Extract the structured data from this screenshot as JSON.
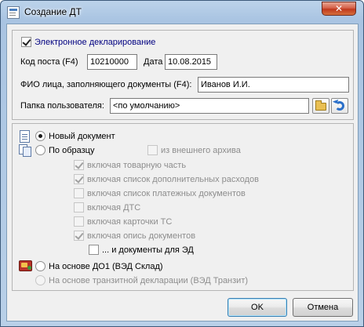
{
  "window": {
    "title": "Создание ДТ",
    "close_glyph": "✕"
  },
  "group1": {
    "e_declaration": {
      "label": "Электронное декларирование",
      "checked": true
    },
    "post_code": {
      "label": "Код поста (F4)",
      "value": "10210000"
    },
    "date": {
      "label": "Дата",
      "value": "10.08.2015"
    },
    "fio": {
      "label": "ФИО лица, заполняющего документы (F4):",
      "value": "Иванов И.И."
    },
    "user_folder": {
      "label": "Папка пользователя:",
      "value": "<по умолчанию>"
    },
    "icons": {
      "browse": "folder-icon",
      "reset": "undo-icon"
    }
  },
  "group2": {
    "new_doc": {
      "label": "Новый документ",
      "selected": true,
      "icon": "document-icon"
    },
    "by_sample": {
      "label": "По образцу",
      "selected": false,
      "icon": "documents-icon"
    },
    "external_archive": {
      "label": "из внешнего архива",
      "checked": false,
      "enabled": false
    },
    "options": [
      {
        "label": "включая товарную часть",
        "checked": true
      },
      {
        "label": "включая список дополнительных расходов",
        "checked": true
      },
      {
        "label": "включая список платежных документов",
        "checked": false
      },
      {
        "label": "включая ДТС",
        "checked": false
      },
      {
        "label": "включая карточки ТС",
        "checked": false
      },
      {
        "label": "включая опись документов",
        "checked": true
      }
    ],
    "ed_docs": {
      "label": "... и документы для ЭД",
      "checked": false,
      "enabled": true
    },
    "based_d01": {
      "label": "На основе ДО1 (ВЭД Склад)",
      "selected": false,
      "icon": "d01-icon"
    },
    "based_transit": {
      "label": "На основе транзитной декларации (ВЭД Транзит)",
      "selected": false,
      "enabled": false
    }
  },
  "footer": {
    "ok_label": "OK",
    "cancel_label": "Отмена"
  },
  "colors": {
    "title_glass": "#b9d0e8",
    "client_bg": "#f0f0f0",
    "close_red": "#c0391d",
    "disabled_text": "#8d8d8d"
  }
}
